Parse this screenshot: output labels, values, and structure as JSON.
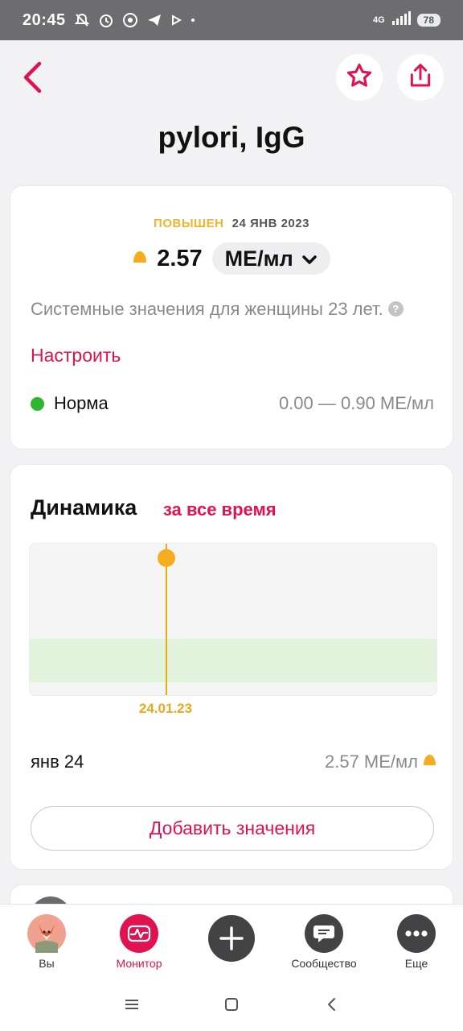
{
  "status_bar": {
    "time": "20:45",
    "network": "4G",
    "battery": "78"
  },
  "header": {
    "title": "pylori, IgG",
    "icons": [
      "back-icon",
      "star-icon",
      "share-icon"
    ]
  },
  "result": {
    "status": "ПОВЫШЕН",
    "date": "24 ЯНВ 2023",
    "value": "2.57",
    "unit": "МЕ/мл",
    "reference_note": "Системные значения для женщины 23 лет.",
    "configure_link": "Настроить",
    "norm_label": "Норма",
    "norm_range": "0.00 — 0.90 МЕ/мл"
  },
  "dynamics": {
    "title": "Динамика",
    "period": "за все время",
    "history": [
      {
        "date": "янв 24",
        "value": "2.57 МЕ/мл"
      }
    ],
    "add_button": "Добавить значения"
  },
  "chart_data": {
    "type": "scatter",
    "x": [
      "24.01.23"
    ],
    "y": [
      2.57
    ],
    "unit": "МЕ/мл",
    "reference_range": [
      0.0,
      0.9
    ],
    "point_color": "#f5ac1e",
    "band_color": "#e2f3dc"
  },
  "bottom_nav": {
    "items": [
      {
        "label": "Вы",
        "icon": "avatar-icon"
      },
      {
        "label": "Монитор",
        "icon": "pulse-icon",
        "active": true
      },
      {
        "label": "",
        "icon": "plus-icon"
      },
      {
        "label": "Сообщество",
        "icon": "chat-icon"
      },
      {
        "label": "Еще",
        "icon": "more-icon"
      }
    ]
  },
  "colors": {
    "accent": "#e0124f",
    "elevated": "#f0b429",
    "normal": "#2fb52f"
  }
}
